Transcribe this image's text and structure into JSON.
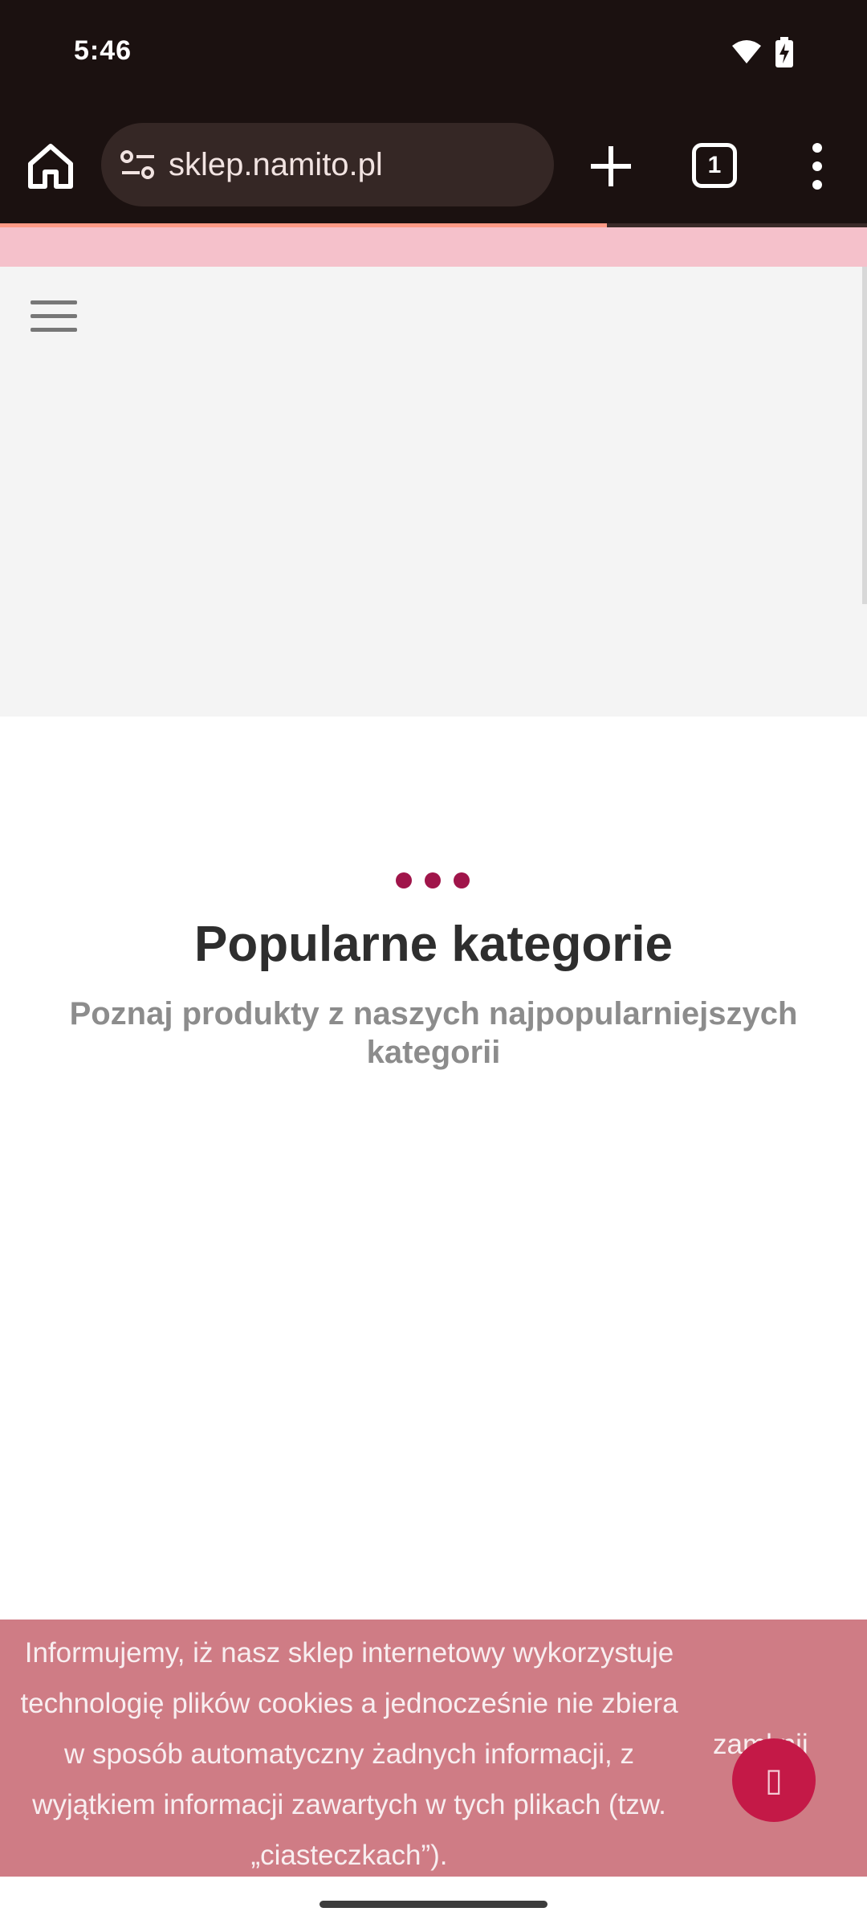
{
  "status_bar": {
    "time": "5:46"
  },
  "browser": {
    "url": "sklep.namito.pl",
    "tab_count": "1",
    "load_progress": 0.7
  },
  "colors": {
    "accent": "#a0154a",
    "cookie_background": "#cf7c85",
    "top_strip": "#f5c1cb"
  },
  "section": {
    "title": "Popularne kategorie",
    "subtitle": "Poznaj produkty z naszych najpopularniejszych kategorii"
  },
  "cookie_notice": {
    "text_lines": [
      "Informujemy, iż nasz sklep internetowy wykorzystuje",
      "technologię plików cookies a jednocześnie nie zbiera",
      "w sposób automatyczny żadnych informacji, z",
      "wyjątkiem informacji zawartych w tych plikach (tzw.",
      "„ciasteczkach”)."
    ],
    "close_label": "zamknij"
  },
  "icons": {
    "home": "home-icon",
    "site_info": "tune-icon",
    "new_tab": "plus-icon",
    "menu": "more-vert-icon",
    "hamburger": "hamburger-icon",
    "fab": "missing-glyph-icon"
  }
}
